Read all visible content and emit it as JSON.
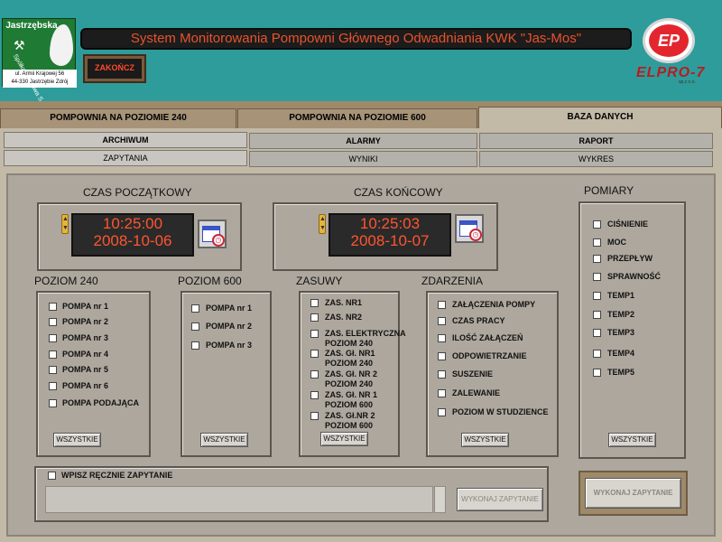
{
  "logo": {
    "top": "Jastrzębska",
    "rot": "Spółka Węglowa S.A.",
    "addr1": "ul. Armii Krajowej 56",
    "addr2": "44-330 Jastrzębie Zdrój"
  },
  "title": "System Monitorowania Pompowni Głównego Odwadniania KWK \"Jas-Mos\"",
  "zakoncz": "ZAKOŃCZ",
  "elpro": {
    "badge": "EP",
    "name": "ELPRO-7",
    "sub": "sp.z o.o."
  },
  "top_tabs": [
    "POMPOWNIA NA POZIOMIE 240",
    "POMPOWNIA NA POZIOMIE 600",
    "BAZA DANYCH"
  ],
  "sub_tabs": [
    "ARCHIWUM",
    "ALARMY",
    "RAPORT"
  ],
  "sub_tabs2": [
    "ZAPYTANIA",
    "WYNIKI",
    "WYKRES"
  ],
  "czas_pocz": {
    "label": "CZAS POCZĄTKOWY",
    "time": "10:25:00",
    "date": "2008-10-06"
  },
  "czas_konc": {
    "label": "CZAS KOŃCOWY",
    "time": "10:25:03",
    "date": "2008-10-07"
  },
  "pomiary": {
    "label": "POMIARY",
    "items": [
      "CIŚNIENIE",
      "MOC",
      "PRZEPŁYW",
      "SPRAWNOŚĆ",
      "TEMP1",
      "TEMP2",
      "TEMP3",
      "TEMP4",
      "TEMP5"
    ]
  },
  "poziom240": {
    "label": "POZIOM 240",
    "items": [
      "POMPA nr 1",
      "POMPA nr 2",
      "POMPA nr 3",
      "POMPA nr 4",
      "POMPA nr 5",
      "POMPA nr 6",
      "POMPA PODAJĄCA"
    ]
  },
  "poziom600": {
    "label": "POZIOM 600",
    "items": [
      "POMPA nr 1",
      "POMPA nr 2",
      "POMPA nr 3"
    ]
  },
  "zasuwy": {
    "label": "ZASUWY",
    "items": [
      "ZAS. NR1",
      "ZAS. NR2",
      "ZAS. ELEKTRYCZNA\nPOZIOM 240",
      "ZAS. Gł. NR1\nPOZIOM 240",
      "ZAS. Gł. NR 2\nPOZIOM 240",
      "ZAS. Gł. NR 1\nPOZIOM 600",
      "ZAS. Gł.NR 2\nPOZIOM 600"
    ]
  },
  "zdarzenia": {
    "label": "ZDARZENIA",
    "items": [
      "ZAŁĄCZENIA POMPY",
      "CZAS PRACY",
      "ILOŚĆ ZAŁĄCZEŃ",
      "ODPOWIETRZANIE",
      "SUSZENIE",
      "ZALEWANIE",
      "POZIOM W STUDZIENCE"
    ]
  },
  "wszystkie": "WSZYSTKIE",
  "manual": {
    "label": "WPISZ RĘCZNIE ZAPYTANIE",
    "run": "WYKONAJ ZAPYTANIE"
  },
  "run_main": "WYKONAJ ZAPYTANIE",
  "colors": {
    "bg": "#2e9c9a",
    "panel": "#c2b9a6",
    "content": "#ada79e",
    "led": "#ff5530"
  }
}
